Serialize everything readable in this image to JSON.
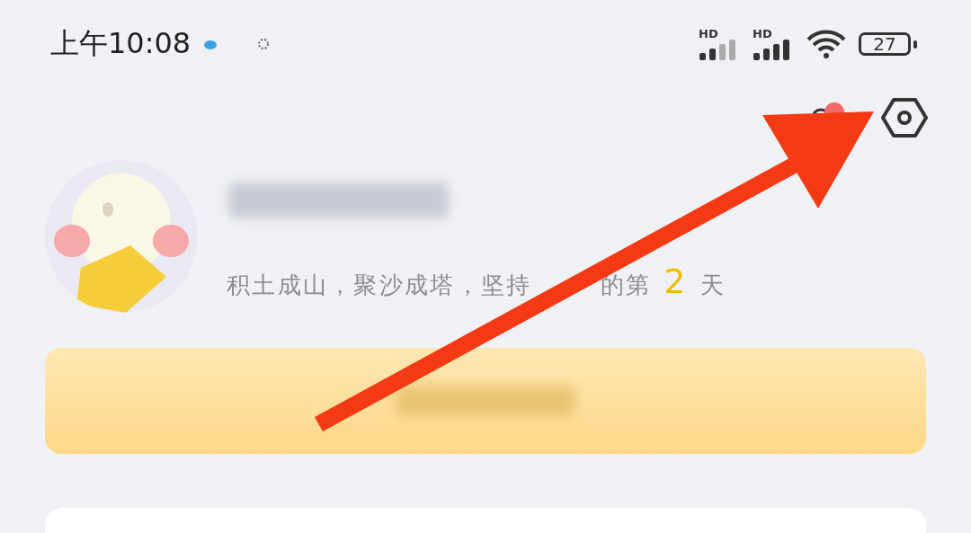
{
  "status_bar": {
    "time": "上午10:08",
    "signals": [
      {
        "label": "HD"
      },
      {
        "label": "HD"
      }
    ],
    "battery": "27"
  },
  "profile": {
    "motto_before": "积土成山，聚沙成塔，坚持",
    "motto_after": "的第",
    "day_count": "2",
    "day_unit": "天"
  }
}
